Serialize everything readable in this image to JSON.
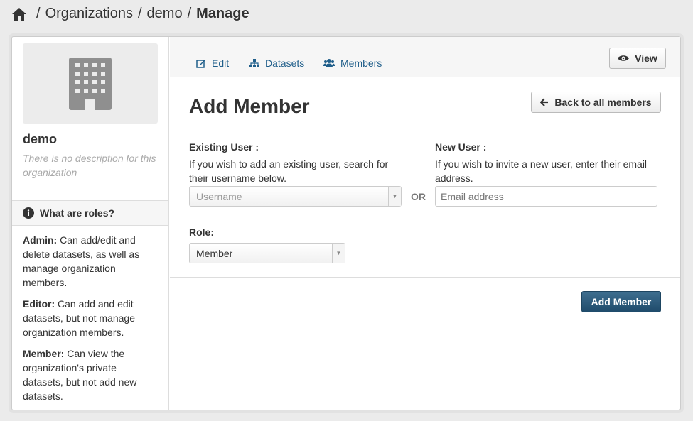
{
  "breadcrumb": {
    "icon": "home-icon",
    "items": [
      "Organizations",
      "demo"
    ],
    "active": "Manage",
    "separator": "/"
  },
  "sidebar": {
    "image_icon": "building-icon",
    "org_name": "demo",
    "org_description": "There is no description for this organization",
    "roles_heading": "What are roles?",
    "roles": [
      {
        "name": "Admin:",
        "description": "Can add/edit and delete datasets, as well as manage organization members."
      },
      {
        "name": "Editor:",
        "description": "Can add and edit datasets, but not manage organization members."
      },
      {
        "name": "Member:",
        "description": "Can view the organization's private datasets, but not add new datasets."
      }
    ]
  },
  "tabs": [
    {
      "label": "Edit",
      "icon": "edit-icon"
    },
    {
      "label": "Datasets",
      "icon": "sitemap-icon"
    },
    {
      "label": "Members",
      "icon": "group-icon"
    }
  ],
  "view_button": {
    "label": "View",
    "icon": "eye-icon"
  },
  "page_title": "Add Member",
  "back_button": {
    "label": "Back to all members",
    "icon": "arrow-left-icon"
  },
  "existing_user": {
    "label": "Existing User :",
    "help": "If you wish to add an existing user, search for their username below.",
    "placeholder": "Username"
  },
  "or_label": "OR",
  "new_user": {
    "label": "New User :",
    "help": "If you wish to invite a new user, enter their email address.",
    "placeholder": "Email address"
  },
  "role": {
    "label": "Role:",
    "selected": "Member"
  },
  "submit_button": {
    "label": "Add Member"
  },
  "colors": {
    "link": "#1f5e8a",
    "primary_button": "#2e5d7f",
    "page_background": "#ebebeb"
  }
}
